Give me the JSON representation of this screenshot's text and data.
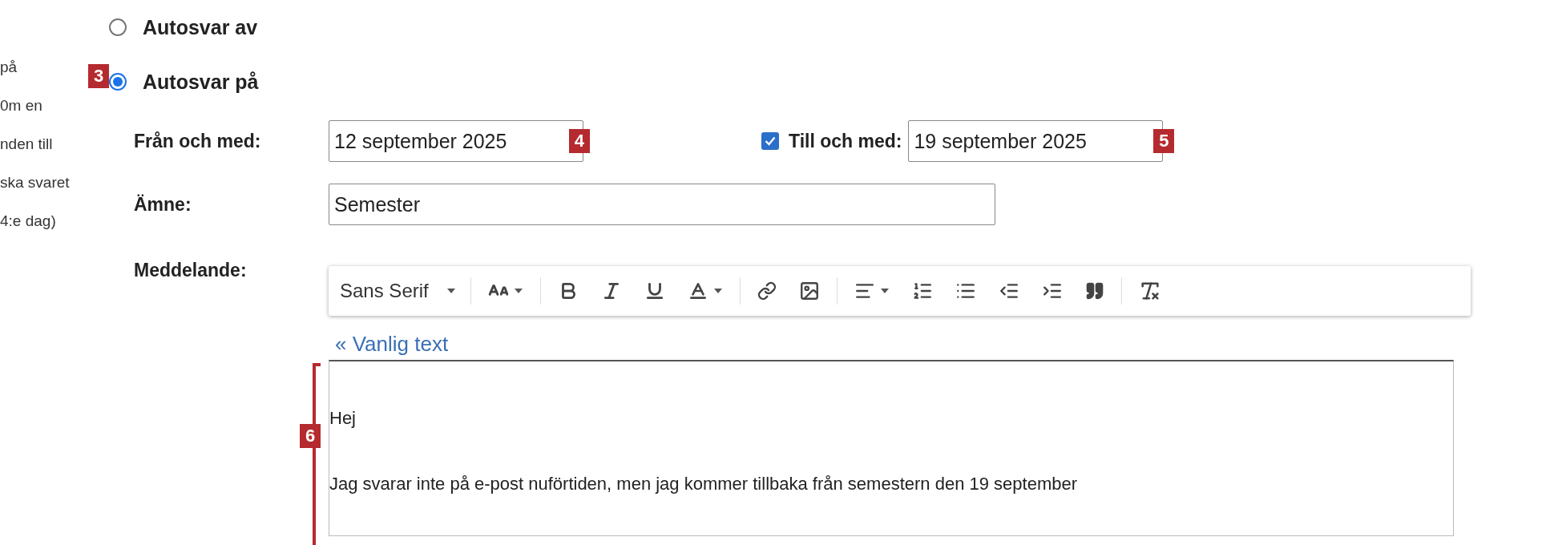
{
  "side_text": [
    "på",
    "0m en",
    "nden till",
    "ska svaret",
    "4:e dag)"
  ],
  "autoreply_options": [
    {
      "label": "Autosvar av",
      "selected": false
    },
    {
      "label": "Autosvar på",
      "selected": true,
      "callout": "3"
    }
  ],
  "start": {
    "label": "Från och med:",
    "value": "12 september 2025",
    "callout": "4"
  },
  "end": {
    "enabled": true,
    "label": "Till och med:",
    "value": "19 september 2025",
    "callout": "5"
  },
  "subject": {
    "label": "Ämne:",
    "value": "Semester"
  },
  "message": {
    "label": "Meddelande:",
    "font": "Sans Serif",
    "plain_text_link": "« Vanlig text",
    "callout": "6",
    "lines": [
      "Hej",
      "Jag svarar inte på e-post nuförtiden, men jag kommer tillbaka från semestern den 19 september"
    ]
  }
}
